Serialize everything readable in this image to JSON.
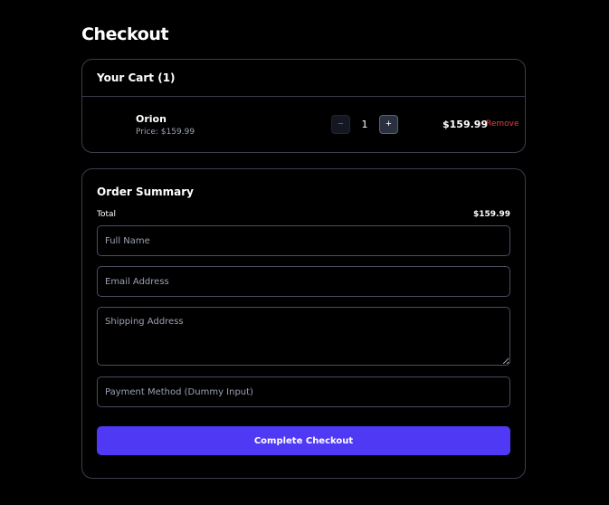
{
  "page": {
    "title": "Checkout"
  },
  "cart": {
    "header": "Your Cart (1)",
    "items": [
      {
        "name": "Orion",
        "price_label": "Price: $159.99",
        "quantity": "1",
        "decrement_symbol": "−",
        "increment_symbol": "+",
        "line_total": "$159.99",
        "remove_label": "Remove"
      }
    ]
  },
  "summary": {
    "title": "Order Summary",
    "total_label": "Total",
    "total_value": "$159.99"
  },
  "form": {
    "full_name": {
      "placeholder": "Full Name",
      "value": ""
    },
    "email": {
      "placeholder": "Email Address",
      "value": ""
    },
    "shipping": {
      "placeholder": "Shipping Address",
      "value": ""
    },
    "payment": {
      "placeholder": "Payment Method (Dummy Input)",
      "value": ""
    },
    "submit_label": "Complete Checkout"
  },
  "colors": {
    "background": "#000000",
    "border": "#3a3d4c",
    "accent": "#5039f5",
    "danger": "#ef3b3b",
    "muted_text": "#9aa0b3"
  }
}
